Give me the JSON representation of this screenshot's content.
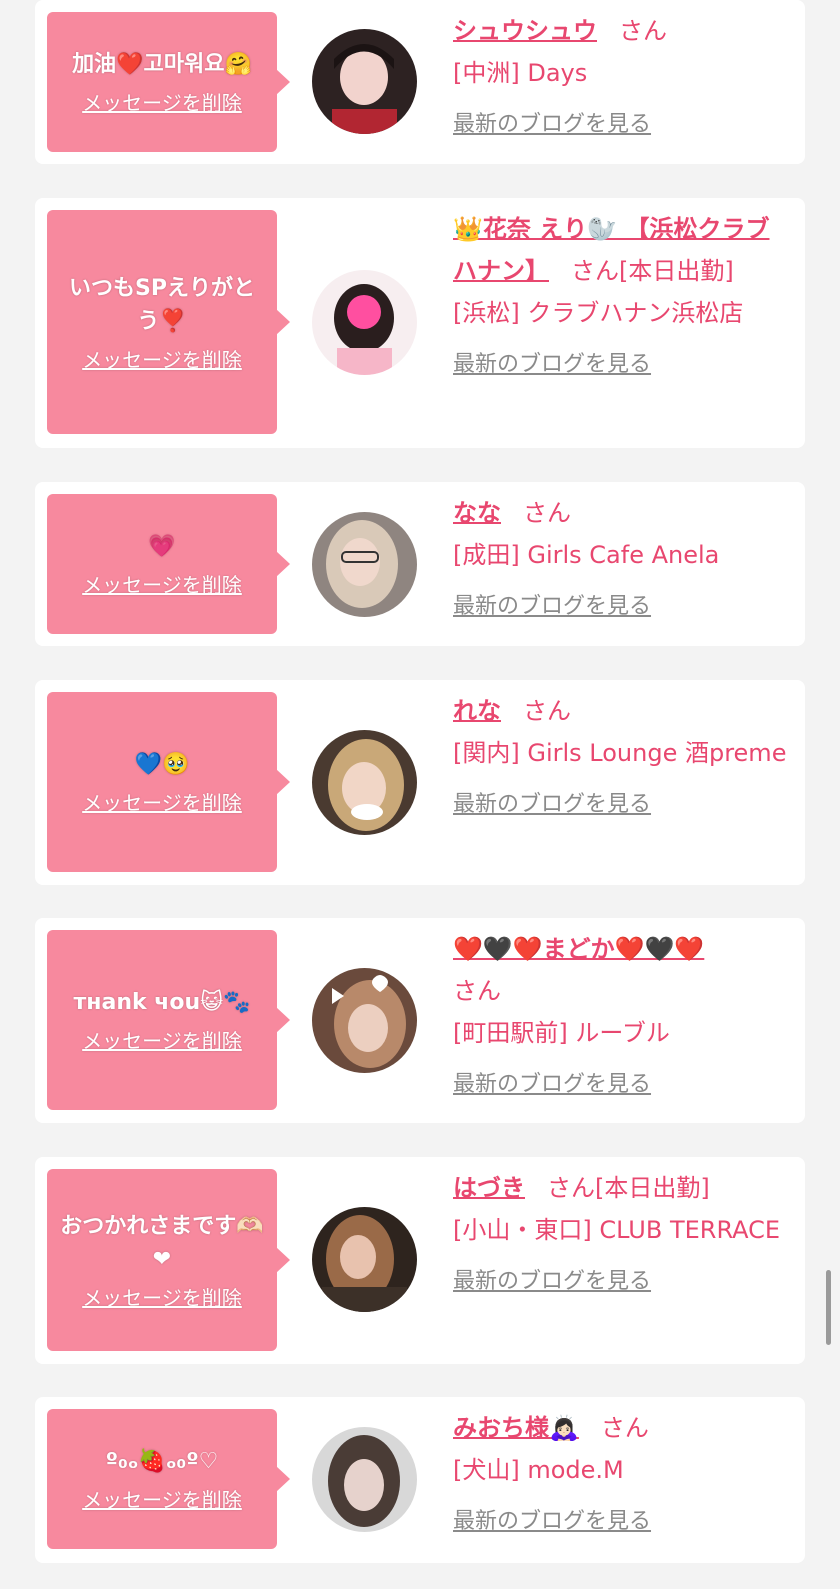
{
  "common": {
    "delete_label": "メッセージを削除",
    "blog_label": "最新のブログを見る",
    "san": "さん"
  },
  "cards": [
    {
      "message": "加油❤️고마워요🤗",
      "name": "シュウシュウ",
      "status": "",
      "shop": "[中洲] Days"
    },
    {
      "message": "いつもSPえりがとう❣️",
      "name": "👑花奈 えり🦭 【浜松クラブハナン】",
      "status": "[本日出勤]",
      "shop": "[浜松] クラブハナン浜松店"
    },
    {
      "message": "💗",
      "name": "なな",
      "status": "",
      "shop": "[成田] Girls Cafe Anela"
    },
    {
      "message": "💙🥹",
      "name": "れな",
      "status": "",
      "shop": "[関内] Girls Lounge 酒preme"
    },
    {
      "message": "тнank чou😺🐾",
      "name": "❤️🖤❤️まどか❤️🖤❤️",
      "status": "",
      "shop": "[町田駅前] ルーブル"
    },
    {
      "message": "おつかれさまです🫶🏻❤",
      "name": "はづき",
      "status": "[本日出勤]",
      "shop": "[小山・東口] CLUB TERRACE"
    },
    {
      "message": "º₀ₒ🍓ₒ₀º♡",
      "name": "みおち様🙇🏻‍♀️",
      "status": "",
      "shop": "[犬山] mode.M"
    }
  ],
  "avatar_colors": [
    "#3a2a2a",
    "#f5e6ea",
    "#9c8e86",
    "#c8b090",
    "#7a5a4a",
    "#3a2b24",
    "#8c8c8c"
  ]
}
